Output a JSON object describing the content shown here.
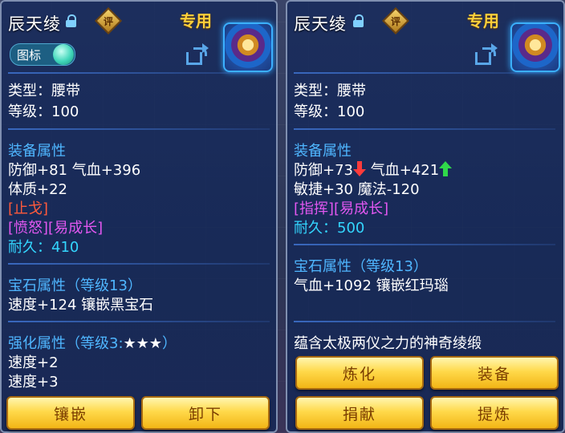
{
  "left": {
    "title": "辰天绫",
    "rating_badge": "评",
    "exclusive_label": "专用",
    "icon_toggle_label": "图标",
    "type_line": "类型：腰带",
    "level_line": "等级：100",
    "equip_header": "装备属性",
    "stat_line_1": "防御+81 气血+396",
    "stat_line_2": "体质+22",
    "special_1": "[止戈]",
    "special_2": "[愤怒][易成长]",
    "durability_label": "耐久：",
    "durability_value": "410",
    "gem_header": "宝石属性（等级13）",
    "gem_line": "速度+124 镶嵌黑宝石",
    "enhance_header": "强化属性（等级3:",
    "enhance_stars": "★★★",
    "enhance_header_end": "）",
    "enhance_line_1": "速度+2",
    "enhance_line_2": "速度+3",
    "buttons": [
      "镶嵌",
      "卸下"
    ]
  },
  "right": {
    "title": "辰天绫",
    "rating_badge": "评",
    "exclusive_label": "专用",
    "type_line": "类型：腰带",
    "level_line": "等级：100",
    "equip_header": "装备属性",
    "stat_line_1a": "防御+73",
    "stat_line_1b": "气血+421",
    "stat_line_2": "敏捷+30 魔法-120",
    "special_1": "[指挥][易成长]",
    "durability_label": "耐久：",
    "durability_value": "500",
    "gem_header": "宝石属性（等级13）",
    "gem_line": "气血+1092 镶嵌红玛瑙",
    "description": "蕴含太极两仪之力的神奇绫缎",
    "buttons": [
      "炼化",
      "装备",
      "捐献",
      "提炼"
    ]
  },
  "colors": {
    "panel_bg": "#14285a",
    "header_blue": "#4fb6ff",
    "special_red": "#ff5a3c",
    "special_pink": "#e157f0",
    "durability_cyan": "#33d6ff",
    "button_gold": "#ffd94a",
    "exclusive_gold": "#ffcf3a"
  },
  "icons": [
    "lock-icon",
    "rating-badge-icon",
    "share-icon",
    "belt-item-icon",
    "down-arrow-icon",
    "up-arrow-icon",
    "toggle-knob"
  ]
}
